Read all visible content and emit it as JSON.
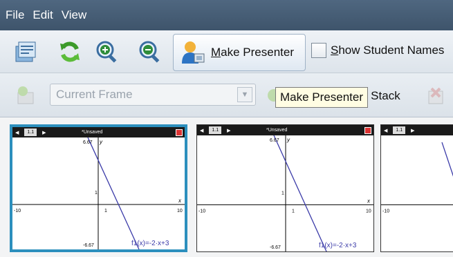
{
  "menu": [
    "File",
    "Edit",
    "View"
  ],
  "toolbar": {
    "make_presenter_label": "Make Presenter",
    "make_presenter_underline": "M",
    "make_presenter_rest": "ake Presenter",
    "show_student_names_underline": "S",
    "show_student_names_rest": "how Student Names"
  },
  "toolbar2": {
    "frame_select_value": "Current Frame",
    "tooltip": "Make Presenter",
    "stack_label_partial": "p Stack"
  },
  "frames": [
    {
      "tab": "1.1",
      "doc": "*Unsaved",
      "y_top": "6.67",
      "y_bottom": "-6.67",
      "x_left": "-10",
      "x_right": "10",
      "y_tick": "1",
      "x_tick": "1",
      "fn_label": "f1(x)=-2·x+3",
      "y_axis": "y",
      "x_axis": "x"
    },
    {
      "tab": "1.1",
      "doc": "*Unsaved",
      "y_top": "6.67",
      "y_bottom": "-6.67",
      "x_left": "-10",
      "x_right": "10",
      "y_tick": "1",
      "x_tick": "1",
      "fn_label": "f1(x)=-2·x+3",
      "y_axis": "y",
      "x_axis": "x"
    },
    {
      "tab": "1.1",
      "x_left": "-10"
    }
  ],
  "colors": {
    "menubar": "#4a6179",
    "selected_frame": "#2c8fbd",
    "function_line": "#3a3aa8"
  }
}
